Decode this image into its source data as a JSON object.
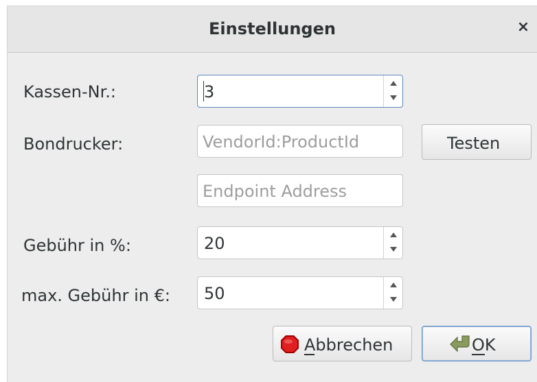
{
  "dialog": {
    "title": "Einstellungen",
    "close_label": "×"
  },
  "form": {
    "kassen_nr": {
      "label": "Kassen-Nr.:",
      "value": "3"
    },
    "bondrucker": {
      "label": "Bondrucker:",
      "vendor_placeholder": "VendorId:ProductId",
      "endpoint_placeholder": "Endpoint Address",
      "test_button": "Testen"
    },
    "gebuehr": {
      "label": "Gebühr in %:",
      "value": "20"
    },
    "max_gebuehr": {
      "label": "max. Gebühr in €:",
      "value": "50"
    }
  },
  "buttons": {
    "cancel": {
      "label_first": "A",
      "label_rest": "bbrechen",
      "icon": "stop-icon",
      "color": "#cc0000"
    },
    "ok": {
      "label_first": "O",
      "label_rest": "K",
      "icon": "ok-arrow-icon",
      "color": "#7a8c56"
    }
  }
}
